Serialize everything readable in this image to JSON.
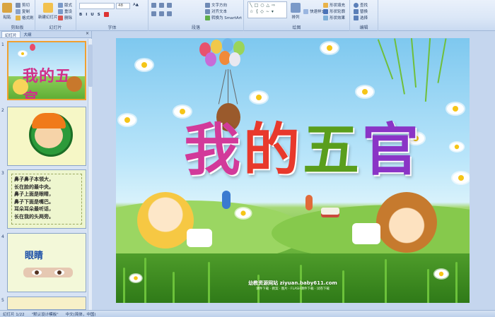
{
  "ribbon": {
    "groups": [
      {
        "label": "剪贴板",
        "buttons": [
          "粘贴",
          "剪切",
          "复制",
          "格式刷"
        ]
      },
      {
        "label": "幻灯片",
        "buttons": [
          "新建幻灯片",
          "版式",
          "重设",
          "删除"
        ]
      },
      {
        "label": "字体",
        "font_size": "48"
      },
      {
        "label": "段落",
        "buttons": [
          "文字方向",
          "对齐文本",
          "转换为 SmartArt"
        ]
      },
      {
        "label": "绘图",
        "buttons": [
          "排列",
          "快速样式",
          "形状填充",
          "形状轮廓",
          "形状效果"
        ]
      },
      {
        "label": "编辑",
        "buttons": [
          "查找",
          "替换",
          "选择"
        ]
      }
    ]
  },
  "thumb_pane": {
    "tabs": [
      "幻灯片",
      "大纲"
    ],
    "close": "×",
    "slides": [
      {
        "num": "1",
        "title": "我的五官"
      },
      {
        "num": "2"
      },
      {
        "num": "3",
        "lines": [
          "鼻子鼻子本领大，",
          "长在脸的最中央。",
          "鼻子上面是眼睛，",
          "鼻子下面是嘴巴。",
          "耳朵耳朵最听话，",
          "长在我的头两旁。"
        ]
      },
      {
        "num": "4",
        "title": "眼睛"
      },
      {
        "num": "5"
      }
    ]
  },
  "slide": {
    "title_chars": [
      {
        "char": "我",
        "color": "#d23a9a"
      },
      {
        "char": "的",
        "color": "#e8392c"
      },
      {
        "char": "五",
        "color": "#5a9e1c"
      },
      {
        "char": "官",
        "color": "#8a34c6"
      }
    ],
    "watermark": "幼教资源网站  ziyuan.baby611.com",
    "watermark_sub": "课件下载  ·  教案  ·  图片  ·  FLASH课件下载  ·  试卷下载"
  },
  "statusbar": {
    "slide_info": "幻灯片 1/22",
    "theme": "\"默认设计模板\"",
    "language": "中文(简体，中国)"
  },
  "colors": {
    "ribbon_bg": "#dbe7f7",
    "selection": "#f0a030",
    "accent": "#1e3a6a"
  }
}
